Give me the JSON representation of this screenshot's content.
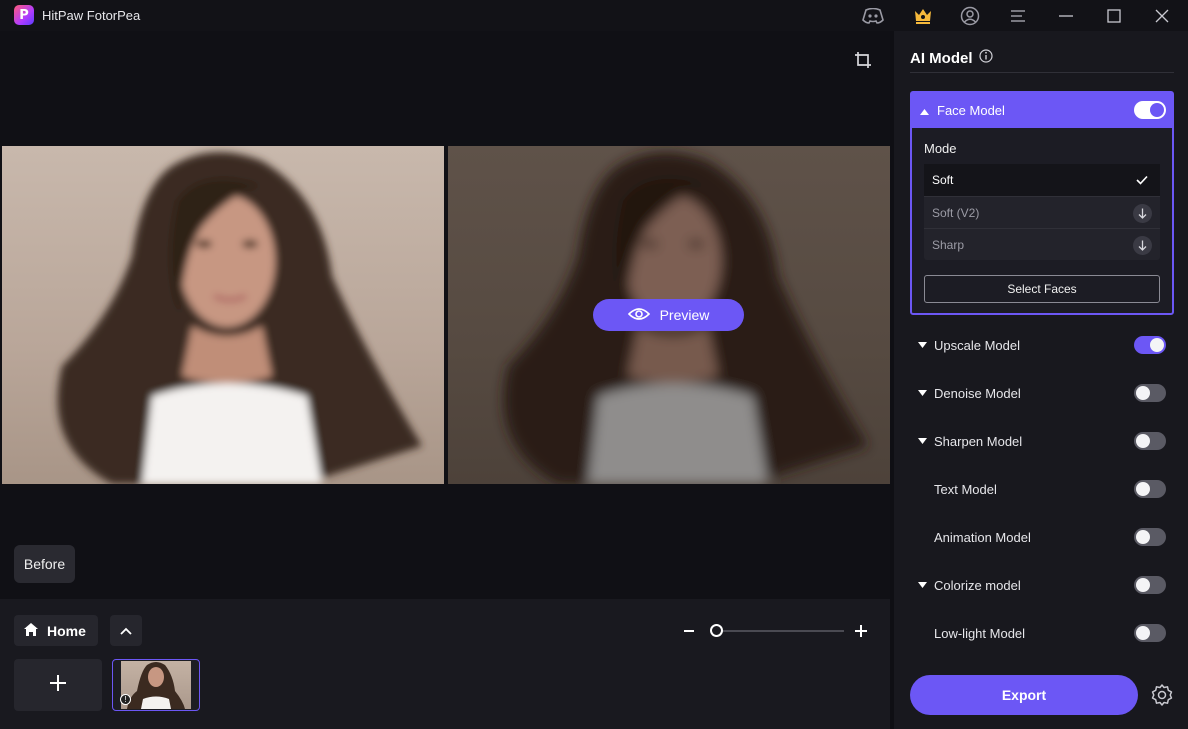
{
  "app": {
    "title": "HitPaw FotorPea",
    "logo_letter": "P"
  },
  "titlebar": {
    "icons": [
      "discord-icon",
      "crown-shop-icon",
      "account-icon",
      "menu-icon",
      "minimize-icon",
      "maximize-icon",
      "close-icon"
    ]
  },
  "canvas": {
    "preview_label": "Preview",
    "before_label": "Before"
  },
  "bottom": {
    "home_label": "Home",
    "zoom": {
      "min_symbol": "−",
      "max_symbol": "+",
      "level": 0
    },
    "thumbnail_info": "!"
  },
  "panel": {
    "title": "AI Model",
    "face_model": {
      "label": "Face Model",
      "enabled": true,
      "mode_label": "Mode",
      "modes": [
        {
          "label": "Soft",
          "state": "selected"
        },
        {
          "label": "Soft (V2)",
          "state": "download"
        },
        {
          "label": "Sharp",
          "state": "download"
        }
      ],
      "select_faces_label": "Select Faces"
    },
    "models": [
      {
        "label": "Upscale Model",
        "expandable": true,
        "enabled": true
      },
      {
        "label": "Denoise Model",
        "expandable": true,
        "enabled": false
      },
      {
        "label": "Sharpen Model",
        "expandable": true,
        "enabled": false
      },
      {
        "label": "Text Model",
        "expandable": false,
        "enabled": false
      },
      {
        "label": "Animation Model",
        "expandable": false,
        "enabled": false
      },
      {
        "label": "Colorize model",
        "expandable": true,
        "enabled": false
      },
      {
        "label": "Low-light Model",
        "expandable": false,
        "enabled": false
      }
    ],
    "export_label": "Export"
  },
  "colors": {
    "accent": "#6c57f5",
    "panel_bg": "#18181e",
    "canvas_bg": "#101015"
  }
}
